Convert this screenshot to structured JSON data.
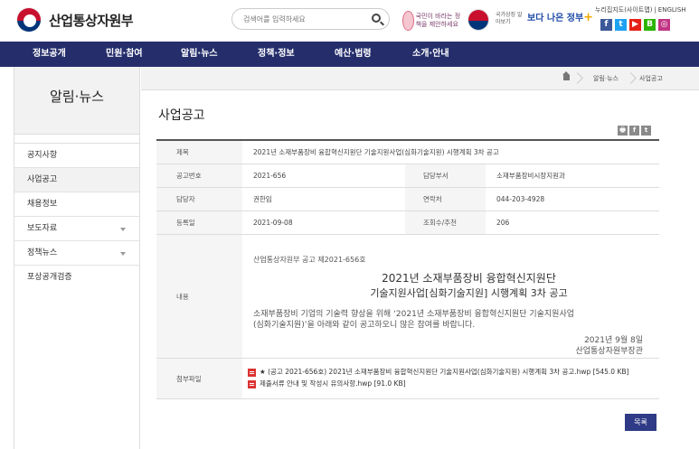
{
  "header": {
    "logo_text": "산업통상자원부",
    "search_placeholder": "검색어를 입력하세요",
    "banner1_text": "국민이 바라는 정책을 제안하세요",
    "banner2_text": "국가상징 알아보기",
    "banner3_text": "보다 나은 정부",
    "util_links": [
      "누리집지도(사이트맵)",
      "ENGLISH"
    ],
    "sns": [
      "f",
      "t",
      "▶",
      "B",
      "◎"
    ]
  },
  "nav": {
    "items": [
      "정보공개",
      "민원·참여",
      "알림·뉴스",
      "정책·정보",
      "예산·법령",
      "소개·안내"
    ]
  },
  "sidebar": {
    "title": "알림·뉴스",
    "items": [
      {
        "label": "공지사항",
        "active": false,
        "expandable": false
      },
      {
        "label": "사업공고",
        "active": true,
        "expandable": false
      },
      {
        "label": "채용정보",
        "active": false,
        "expandable": false
      },
      {
        "label": "보도자료",
        "active": false,
        "expandable": true
      },
      {
        "label": "정책뉴스",
        "active": false,
        "expandable": true
      },
      {
        "label": "포상공개검증",
        "active": false,
        "expandable": false
      }
    ]
  },
  "breadcrumb": [
    "알림·뉴스",
    "사업공고"
  ],
  "page_title": "사업공고",
  "share": [
    "🖶",
    "f",
    "t"
  ],
  "board": {
    "title_label": "제목",
    "title_value": "2021년 소재부품장비 융합혁신지원단 기술지원사업(심화기술지원) 시행계획 3차 공고",
    "notice_no_label": "공고번호",
    "notice_no_value": "2021-656",
    "dept_label": "담당부서",
    "dept_value": "소재부품장비시장지원과",
    "manager_label": "담당자",
    "manager_value": "권한임",
    "contact_label": "연락처",
    "contact_value": "044-203-4928",
    "date_label": "등록일",
    "date_value": "2021-09-08",
    "views_label": "조회수/추천",
    "views_value": "206",
    "content_label": "내용",
    "content": {
      "notice_no": "산업통상자원부 공고 제2021-656호",
      "title_line1": "2021년 소재부품장비 융합혁신지원단",
      "title_line2": "기술지원사업[심화기술지원] 시행계획 3차 공고",
      "body_line1": "소재부품장비 기업의 기술력 향상을 위해 ‘2021년 소재부품장비 융합혁신지원단 기술지원사업",
      "body_line2": "(심화기술지원)’을 아래와 같이 공고하오니 많은 참여를 바랍니다.",
      "date": "2021년 9월 8일",
      "issuer": "산업통상자원부장관"
    },
    "attach_label": "첨부파일",
    "files": [
      "★ (공고 2021-656호) 2021년 소재부품장비 융합혁신지원단 기술지원사업(심화기술지원) 시행계획 3차 공고.hwp [545.0 KB]",
      "제출서류 안내 및 작성시 유의사항.hwp [91.0 KB]"
    ]
  },
  "list_button": "목록",
  "colors": {
    "nav_bg": "#252e6b",
    "button_bg": "#2f3b86"
  }
}
